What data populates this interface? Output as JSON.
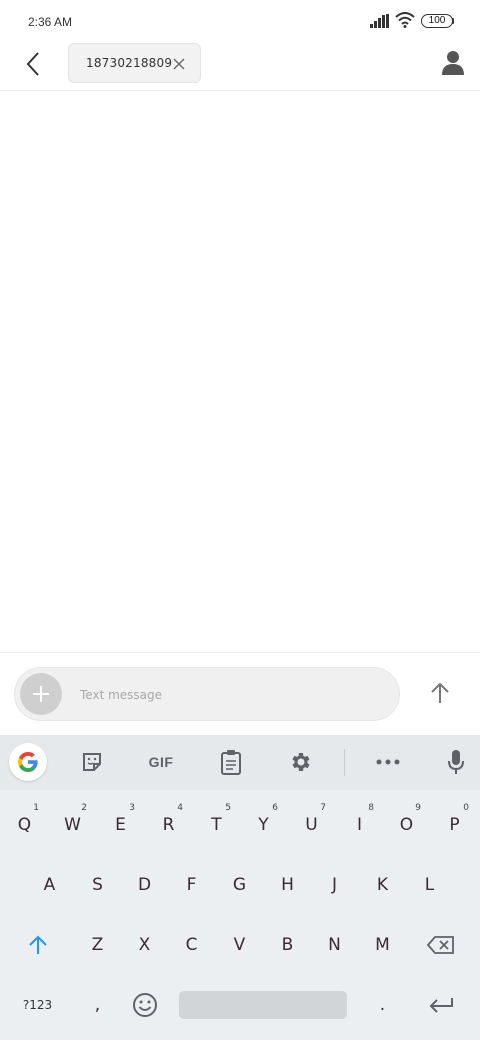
{
  "status_bar": {
    "time": "2:36 AM",
    "battery": "100"
  },
  "header": {
    "recipient": "18730218809"
  },
  "compose": {
    "placeholder": "Text message"
  },
  "keyboard": {
    "toolbar": {
      "gif_label": "GIF"
    },
    "row1": [
      {
        "label": "Q",
        "hint": "1"
      },
      {
        "label": "W",
        "hint": "2"
      },
      {
        "label": "E",
        "hint": "3"
      },
      {
        "label": "R",
        "hint": "4"
      },
      {
        "label": "T",
        "hint": "5"
      },
      {
        "label": "Y",
        "hint": "6"
      },
      {
        "label": "U",
        "hint": "7"
      },
      {
        "label": "I",
        "hint": "8"
      },
      {
        "label": "O",
        "hint": "9"
      },
      {
        "label": "P",
        "hint": "0"
      }
    ],
    "row2": [
      "A",
      "S",
      "D",
      "F",
      "G",
      "H",
      "J",
      "K",
      "L"
    ],
    "row3": [
      "Z",
      "X",
      "C",
      "V",
      "B",
      "N",
      "M"
    ],
    "row4": {
      "symbols": "?123",
      "comma": ",",
      "period": "."
    }
  },
  "colors": {
    "key_text": "#3a2a35",
    "shift_accent": "#2196f3",
    "keyboard_bg": "#eceff1"
  }
}
